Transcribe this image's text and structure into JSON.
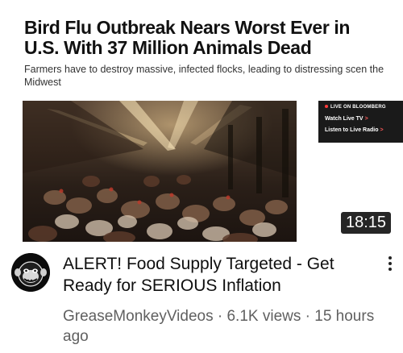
{
  "thumbnail": {
    "headline": "Bird Flu Outbreak Nears Worst Ever in U.S. With 37 Million Animals Dead",
    "dek": "Farmers have to destroy massive, infected flocks, leading to distressing scen the Midwest",
    "bloomberg": {
      "live_label": "LIVE ON BLOOMBERG",
      "watch_tv": "Watch Live TV",
      "listen_radio": "Listen to Live Radio",
      "chevron": ">"
    },
    "duration": "18:15"
  },
  "video": {
    "title": "ALERT!  Food Supply Targeted - Get Ready for SERIOUS Inflation",
    "channel": "GreaseMonkeyVideos",
    "views": "6.1K views",
    "age": "15 hours ago",
    "separator": "·"
  },
  "icons": {
    "menu": "more-vert-icon",
    "avatar": "monkey-avatar-icon"
  },
  "colors": {
    "meta_text": "#606060",
    "title_text": "#0f0f0f",
    "duration_bg": "#000000",
    "live_dot": "#ff3b3b"
  }
}
